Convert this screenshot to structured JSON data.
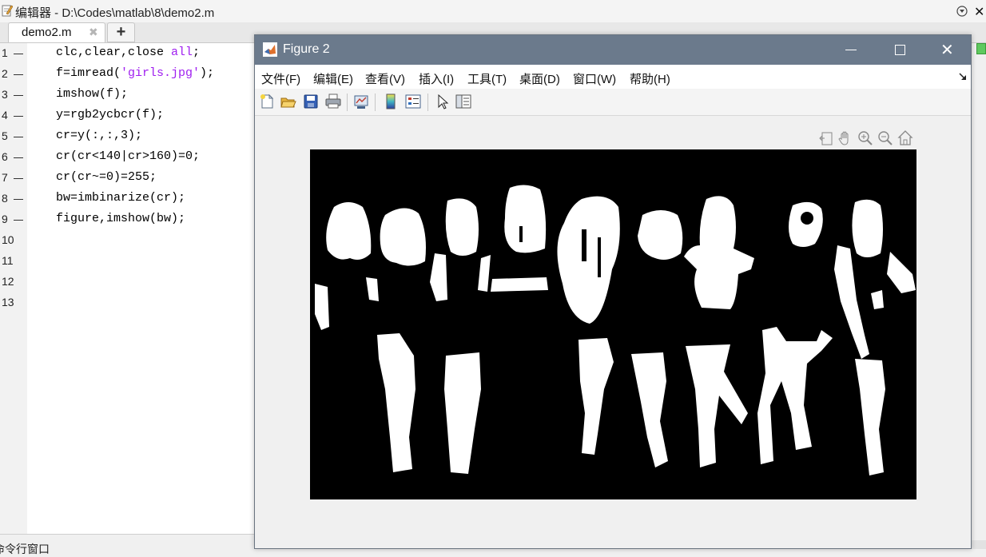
{
  "editor": {
    "title": "编辑器 - D:\\Codes\\matlab\\8\\demo2.m",
    "tab_label": "demo2.m",
    "tab_close": "✖",
    "tab_add": "+",
    "lines": [
      {
        "num": "1",
        "code": "clc,clear,close ",
        "kw": "all",
        "tail": ";"
      },
      {
        "num": "2",
        "code": "f=imread(",
        "kw": "'girls.jpg'",
        "tail": ");"
      },
      {
        "num": "3",
        "code": "imshow(f);",
        "kw": "",
        "tail": ""
      },
      {
        "num": "4",
        "code": "y=rgb2ycbcr(f);",
        "kw": "",
        "tail": ""
      },
      {
        "num": "5",
        "code": "cr=y(:,:,3);",
        "kw": "",
        "tail": ""
      },
      {
        "num": "6",
        "code": "cr(cr<140|cr>160)=0;",
        "kw": "",
        "tail": ""
      },
      {
        "num": "7",
        "code": "cr(cr~=0)=255;",
        "kw": "",
        "tail": ""
      },
      {
        "num": "8",
        "code": "bw=imbinarize(cr);",
        "kw": "",
        "tail": ""
      },
      {
        "num": "9",
        "code": "figure,imshow(bw);",
        "kw": "",
        "tail": ""
      },
      {
        "num": "10",
        "code": "",
        "kw": "",
        "tail": ""
      },
      {
        "num": "11",
        "code": "",
        "kw": "",
        "tail": ""
      },
      {
        "num": "12",
        "code": "",
        "kw": "",
        "tail": ""
      },
      {
        "num": "13",
        "code": "",
        "kw": "",
        "tail": ""
      }
    ],
    "bottom_panel": "命令行窗口"
  },
  "figure": {
    "title": "Figure 2",
    "menus": [
      "文件(F)",
      "编辑(E)",
      "查看(V)",
      "插入(I)",
      "工具(T)",
      "桌面(D)",
      "窗口(W)",
      "帮助(H)"
    ],
    "toolbar_icons": [
      "new-figure-icon",
      "open-file-icon",
      "save-icon",
      "print-icon",
      "link-plot-icon",
      "colorbar-icon",
      "legend-icon",
      "edit-plot-icon",
      "property-inspector-icon"
    ],
    "axes_toolbar_icons": [
      "export-icon",
      "pan-hand-icon",
      "zoom-in-icon",
      "zoom-out-icon",
      "home-icon"
    ],
    "image_description_colors": {
      "background": "#000000",
      "foreground": "#ffffff"
    }
  },
  "colors": {
    "figure_titlebar": "#6b7a8c",
    "keyword": "#a020f0"
  }
}
